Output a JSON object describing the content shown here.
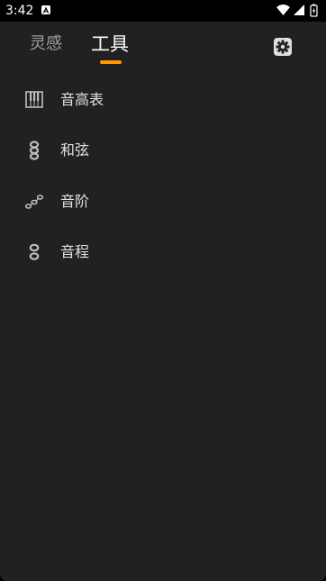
{
  "status_bar": {
    "time": "3:42"
  },
  "tabs": [
    {
      "label": "灵感",
      "active": false
    },
    {
      "label": "工具",
      "active": true
    }
  ],
  "accent_color": "#ff9800",
  "settings_icon": "gear-icon",
  "tools": [
    {
      "label": "音高表",
      "icon": "piano-icon"
    },
    {
      "label": "和弦",
      "icon": "chord-icon"
    },
    {
      "label": "音阶",
      "icon": "scale-icon"
    },
    {
      "label": "音程",
      "icon": "interval-icon"
    }
  ]
}
